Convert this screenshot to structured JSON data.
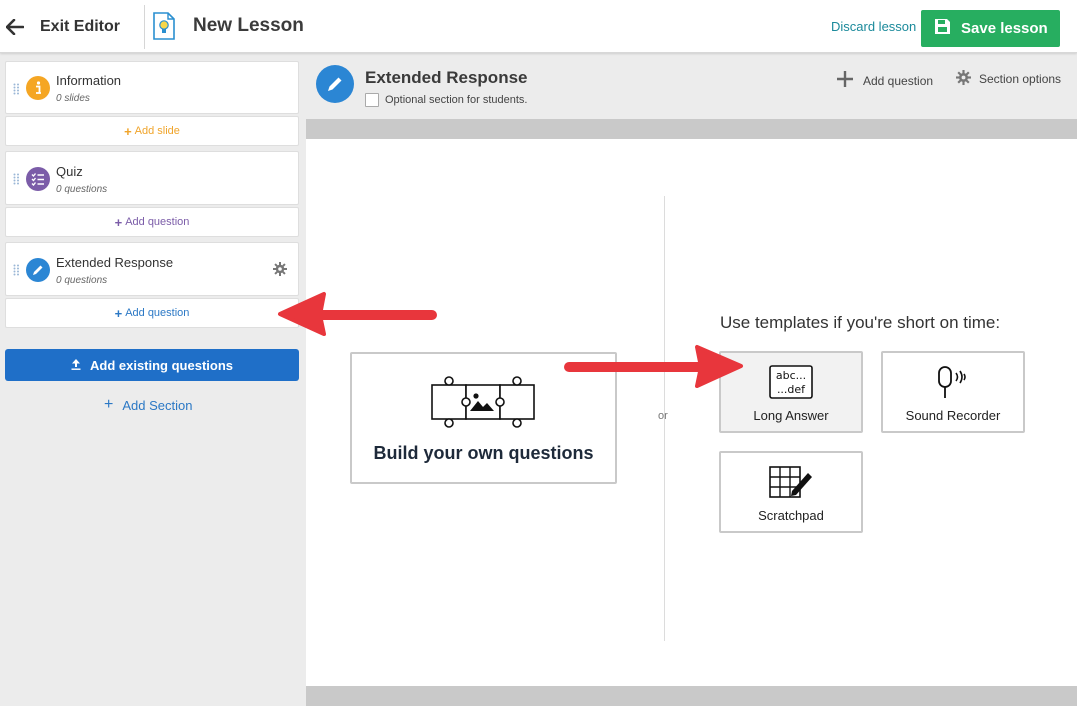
{
  "header": {
    "exit_label": "Exit Editor",
    "lesson_title": "New Lesson",
    "discard_label": "Discard lesson",
    "save_label": "Save lesson",
    "save_color": "#27ae60",
    "icons": {
      "back": "arrow-left-icon",
      "lesson": "lightbulb-document-icon",
      "save": "floppy-disk-icon"
    }
  },
  "sidebar": {
    "sections": [
      {
        "name": "Information",
        "count": "0 slides",
        "icon": "info-icon",
        "icon_color": "#f5a623",
        "add_label": "Add slide",
        "add_color": "#f0a42a"
      },
      {
        "name": "Quiz",
        "count": "0 questions",
        "icon": "checklist-icon",
        "icon_color": "#7b5ca8",
        "add_label": "Add question",
        "add_color": "#7b5ca8"
      },
      {
        "name": "Extended Response",
        "count": "0 questions",
        "icon": "pencil-icon",
        "icon_color": "#2b86d4",
        "add_label": "Add question",
        "add_color": "#2b78c5"
      }
    ],
    "add_existing_label": "Add existing questions",
    "add_section_label": "Add Section"
  },
  "section_header": {
    "title": "Extended Response",
    "optional_label": "Optional section for students.",
    "add_question_label": "Add question",
    "section_options_label": "Section options"
  },
  "canvas": {
    "build_label": "Build your own questions",
    "or_label": "or",
    "templates_heading": "Use templates if you're short on time:",
    "templates": [
      {
        "label": "Long Answer",
        "icon": "abc-def-text-icon"
      },
      {
        "label": "Sound Recorder",
        "icon": "microphone-icon"
      },
      {
        "label": "Scratchpad",
        "icon": "grid-pencil-icon"
      }
    ],
    "abc_text": "abc...",
    "def_text": "...def"
  }
}
